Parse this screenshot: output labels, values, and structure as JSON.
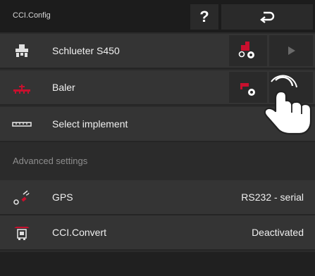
{
  "header": {
    "title": "CCI.Config",
    "help_label": "?",
    "back_icon": "back-arrow-icon"
  },
  "rows": [
    {
      "label": "Schlueter S450",
      "icon": "tractor-icon"
    },
    {
      "label": "Baler",
      "icon": "baler-implement-icon"
    },
    {
      "label": "Select implement",
      "icon": "implement-bar-icon"
    }
  ],
  "section": {
    "label": "Advanced settings"
  },
  "settings": [
    {
      "label": "GPS",
      "value": "RS232 - serial",
      "icon": "gps-satellite-icon"
    },
    {
      "label": "CCI.Convert",
      "value": "Deactivated",
      "icon": "cci-convert-icon"
    }
  ],
  "colors": {
    "accent_red": "#c8102e",
    "background": "#2b2b2b",
    "row": "#343434"
  }
}
